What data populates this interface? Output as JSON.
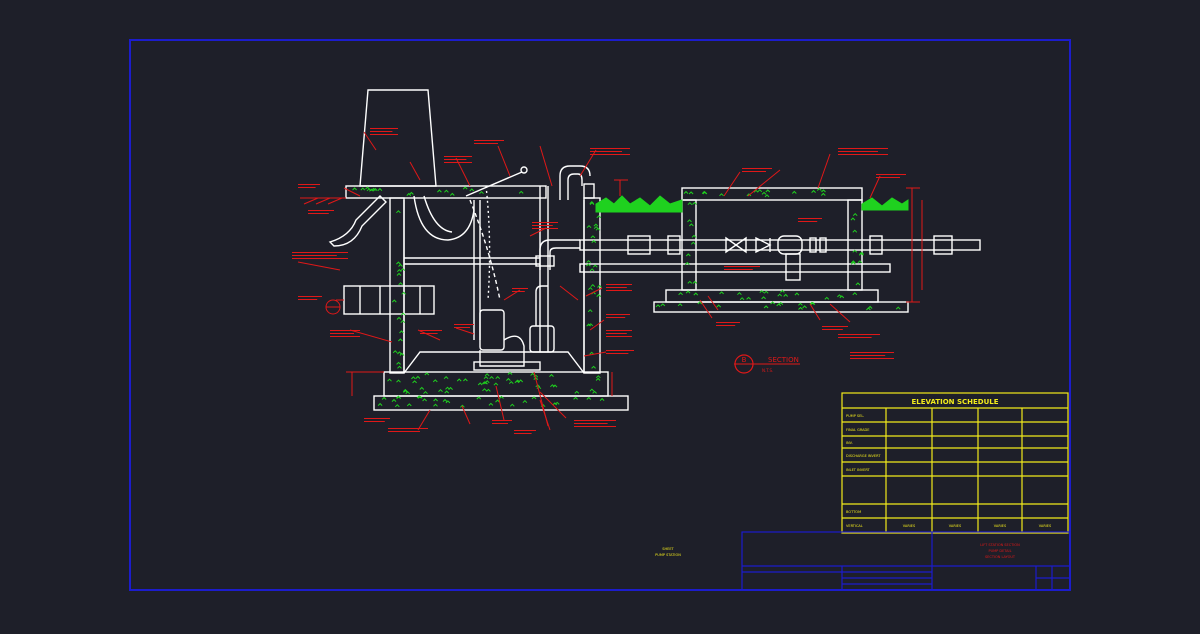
{
  "colors": {
    "background": "#1e1f29",
    "frame": "#1c1ccc",
    "linework": "#ffffff",
    "annotation": "#e01818",
    "vegetation": "#1fd11f",
    "schedule": "#f2ea1c"
  },
  "section_marker": {
    "symbol": "B",
    "label": "SECTION",
    "scale_note": "N.T.S."
  },
  "elevation_schedule": {
    "title": "ELEVATION SCHEDULE",
    "row_labels": [
      "PUMP SEL.",
      "FINAL GRADE",
      "INV.",
      "DISCHARGE INVERT",
      "INLET INVERT",
      "",
      "BOTTOM",
      "VERTICAL"
    ],
    "bottom_cells": [
      "VARIES",
      "VARIES",
      "VARIES",
      "VARIES",
      "VARIES"
    ]
  },
  "title_block": {
    "center_note_1": "SHEET",
    "center_note_2": "PUMP STATION",
    "right_line_1": "LIFT STATION SECTION",
    "right_line_2": "PUMP DETAIL",
    "right_line_3": "SECTION LAYOUT"
  },
  "icons": [
    "section-marker-icon",
    "grass-icon",
    "gate-valve-icon",
    "check-valve-icon"
  ]
}
